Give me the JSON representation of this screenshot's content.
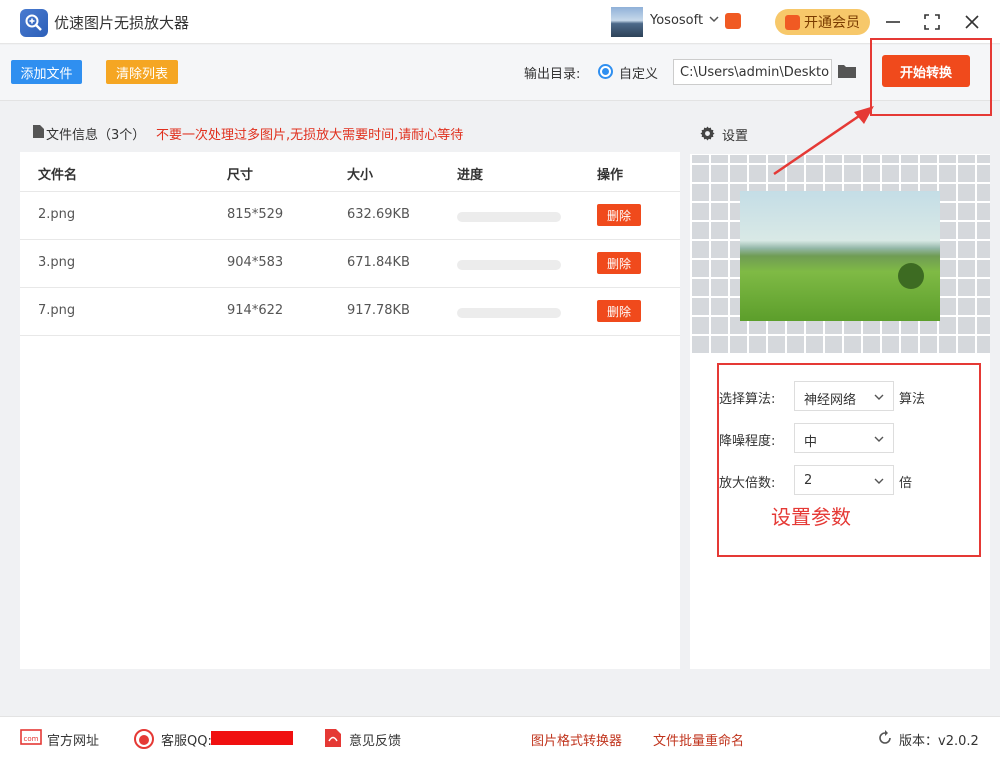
{
  "titlebar": {
    "app_title": "优速图片无损放大器",
    "username": "Yososoft",
    "vip_label": "开通会员"
  },
  "toolbar": {
    "add_file": "添加文件",
    "clear_list": "清除列表",
    "output_dir_label": "输出目录:",
    "radio_custom": "自定义",
    "output_path": "C:\\Users\\admin\\Deskto",
    "start_button": "开始转换"
  },
  "file_panel": {
    "info_label": "文件信息（3个）",
    "warning": "不要一次处理过多图片,无损放大需要时间,请耐心等待",
    "columns": [
      "文件名",
      "尺寸",
      "大小",
      "进度",
      "操作"
    ],
    "rows": [
      {
        "name": "2.png",
        "size": "815*529",
        "bytes": "632.69KB",
        "progress": 0,
        "action": "删除"
      },
      {
        "name": "3.png",
        "size": "904*583",
        "bytes": "671.84KB",
        "progress": 0,
        "action": "删除"
      },
      {
        "name": "7.png",
        "size": "914*622",
        "bytes": "917.78KB",
        "progress": 0,
        "action": "删除"
      }
    ]
  },
  "settings": {
    "title": "设置",
    "algorithm_label": "选择算法:",
    "algorithm_value": "神经网络",
    "algorithm_suffix": "算法",
    "denoise_label": "降噪程度:",
    "denoise_value": "中",
    "scale_label": "放大倍数:",
    "scale_value": "2",
    "scale_suffix": "倍",
    "annotation": "设置参数"
  },
  "footer": {
    "website": "官方网址",
    "support_qq": "客服QQ:",
    "feedback": "意见反馈",
    "format_converter": "图片格式转换器",
    "batch_rename": "文件批量重命名",
    "version": "版本：v2.0.2"
  },
  "colors": {
    "primary_blue": "#2f8ff0",
    "action_orange": "#f04a1c",
    "clear_yellow": "#f5a623",
    "annotation_red": "#e53935",
    "vip_gold": "#f7c86a"
  }
}
